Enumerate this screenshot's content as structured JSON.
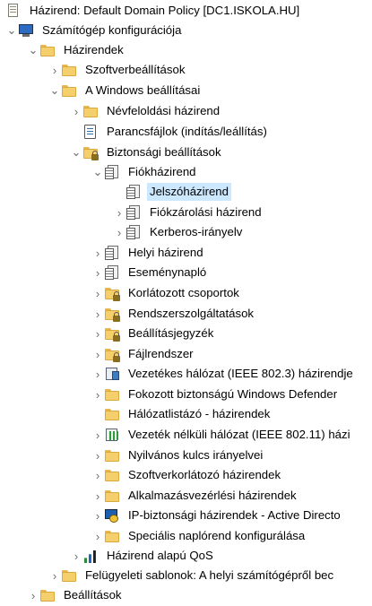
{
  "tree": {
    "root": "Házirend: Default Domain Policy [DC1.ISKOLA.HU]",
    "computer_config": "Számítógép konfigurációja",
    "policies": "Házirendek",
    "software_settings": "Szoftverbeállítások",
    "windows_settings": "A Windows beállításai",
    "name_resolution": "Névfeloldási házirend",
    "scripts": "Parancsfájlok (indítás/leállítás)",
    "security_settings": "Biztonsági beállítások",
    "account_policies": "Fiókházirend",
    "password_policy": "Jelszóházirend",
    "lockout_policy": "Fiókzárolási házirend",
    "kerberos_policy": "Kerberos-irányelv",
    "local_policies": "Helyi házirend",
    "event_log": "Eseménynapló",
    "restricted_groups": "Korlátozott csoportok",
    "system_services": "Rendszerszolgáltatások",
    "registry": "Beállításjegyzék",
    "file_system": "Fájlrendszer",
    "wired_network": "Vezetékes hálózat (IEEE 802.3) házirendje",
    "windows_defender": "Fokozott biztonságú Windows Defender",
    "network_list": "Hálózatlistázó - házirendek",
    "wireless_network": "Vezeték nélküli hálózat (IEEE 802.11) házi",
    "public_key": "Nyilvános kulcs irányelvei",
    "software_restriction": "Szoftverkorlátozó házirendek",
    "app_control": "Alkalmazásvezérlési házirendek",
    "ipsec": "IP-biztonsági házirendek - Active Directo",
    "advanced_audit": "Speciális naplórend konfigurálása",
    "qos": "Házirend alapú QoS",
    "admin_templates": "Felügyeleti sablonok: A helyi számítógépről bec",
    "preferences": "Beállítások"
  },
  "icons": {
    "policy": "policy-doc-icon",
    "folder": "folder-icon",
    "computer": "computer-icon"
  },
  "colors": {
    "selection": "#cce8ff",
    "folder": "#f5cf6b"
  }
}
